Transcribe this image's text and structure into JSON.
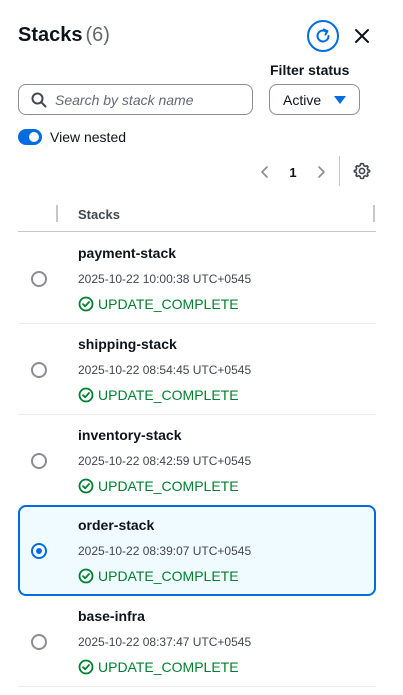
{
  "panel": {
    "title": "Stacks",
    "count": "(6)"
  },
  "filter": {
    "label": "Filter status",
    "selected": "Active"
  },
  "search": {
    "placeholder": "Search by stack name"
  },
  "toggle": {
    "label": "View nested",
    "on": true
  },
  "pagination": {
    "page": "1"
  },
  "table": {
    "column_header": "Stacks"
  },
  "stacks": [
    {
      "name": "payment-stack",
      "time": "2025-10-22 10:00:38 UTC+0545",
      "status": "UPDATE_COMPLETE",
      "selected": false
    },
    {
      "name": "shipping-stack",
      "time": "2025-10-22 08:54:45 UTC+0545",
      "status": "UPDATE_COMPLETE",
      "selected": false
    },
    {
      "name": "inventory-stack",
      "time": "2025-10-22 08:42:59 UTC+0545",
      "status": "UPDATE_COMPLETE",
      "selected": false
    },
    {
      "name": "order-stack",
      "time": "2025-10-22 08:39:07 UTC+0545",
      "status": "UPDATE_COMPLETE",
      "selected": true
    },
    {
      "name": "base-infra",
      "time": "2025-10-22 08:37:47 UTC+0545",
      "status": "UPDATE_COMPLETE",
      "selected": false
    }
  ],
  "icons": {
    "refresh": "refresh-icon",
    "close": "close-icon",
    "search": "search-icon",
    "caret": "caret-down-icon",
    "prev": "chevron-left-icon",
    "next": "chevron-right-icon",
    "settings": "gear-icon",
    "status": "check-circle-icon"
  },
  "colors": {
    "accent": "#006ce0",
    "success": "#00802f",
    "selected_bg": "#f0fbff"
  }
}
